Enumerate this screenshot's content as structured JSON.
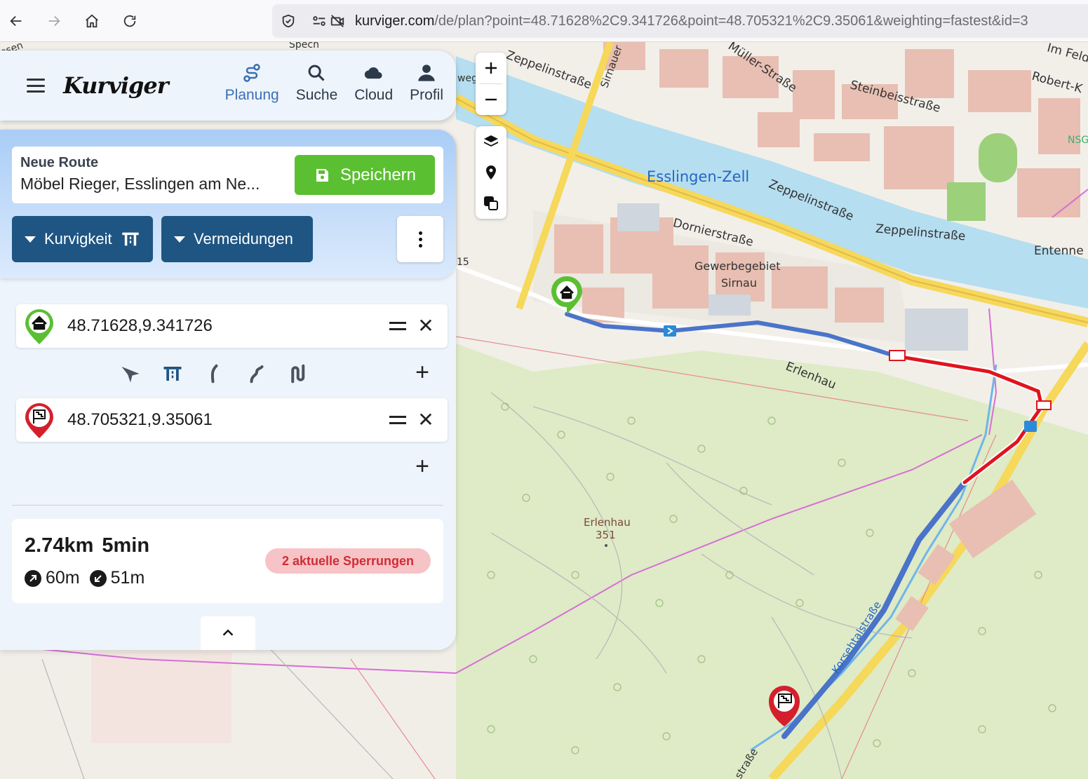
{
  "browser": {
    "url_host": "kurviger.com",
    "url_path": "/de/plan?point=48.71628%2C9.341726&point=48.705321%2C9.35061&weighting=fastest&id=3"
  },
  "app": {
    "logo": "Kurviger",
    "nav": [
      {
        "label": "Planung",
        "icon": "route-icon",
        "active": true
      },
      {
        "label": "Suche",
        "icon": "search-icon",
        "active": false
      },
      {
        "label": "Cloud",
        "icon": "cloud-icon",
        "active": false
      },
      {
        "label": "Profil",
        "icon": "user-icon",
        "active": false
      }
    ]
  },
  "route": {
    "title": "Neue Route",
    "name": "Möbel Rieger, Esslingen am Ne...",
    "save_label": "Speichern",
    "curviness_label": "Kurvigkeit",
    "avoid_label": "Vermeidungen"
  },
  "waypoints": [
    {
      "value": "48.71628,9.341726",
      "type": "start",
      "icon": "home-icon"
    },
    {
      "value": "48.705321,9.35061",
      "type": "destination",
      "icon": "flag-icon"
    }
  ],
  "profiles": [
    "fastest-icon",
    "highway-icon",
    "curvy-icon",
    "curvier-icon",
    "curviest-icon"
  ],
  "stats": {
    "distance": "2.74km",
    "duration": "5min",
    "ascent": "60m",
    "descent": "51m",
    "closures": "2 aktuelle Sperrungen"
  },
  "map": {
    "labels": {
      "zeppelin1": "Zeppelinstraße",
      "zeppelin2": "Zeppelinstraße",
      "zeppelin3": "Zeppelinstraße",
      "sirnauer": "Sirnauer",
      "mueller": "Müller-Straße",
      "steinbeis": "Steinbeisstraße",
      "zell": "Esslingen-Zell",
      "dornier": "Dornierstraße",
      "gewerbe1": "Gewerbegebiet",
      "gewerbe2": "Sirnau",
      "erlenhau": "Erlenhau",
      "erlenhau_peak": "Erlenhau",
      "elevation": "351",
      "entenne": "Entenne",
      "imfeld": "Im Feld",
      "robert": "Robert-K",
      "korsch": "Korsehtalstraße",
      "strasse": "straße",
      "nsg": "NSG",
      "num15": "15",
      "weg": "weg",
      "spech": "Spech",
      "wiesen": "esen"
    },
    "colors": {
      "route": "#4a74c9",
      "closure": "#e0141e",
      "river": "#b5def0",
      "forest": "#dfeac7",
      "road_major": "#f6d85a",
      "start_pin": "#5bbf32",
      "end_pin": "#d4202c"
    }
  }
}
